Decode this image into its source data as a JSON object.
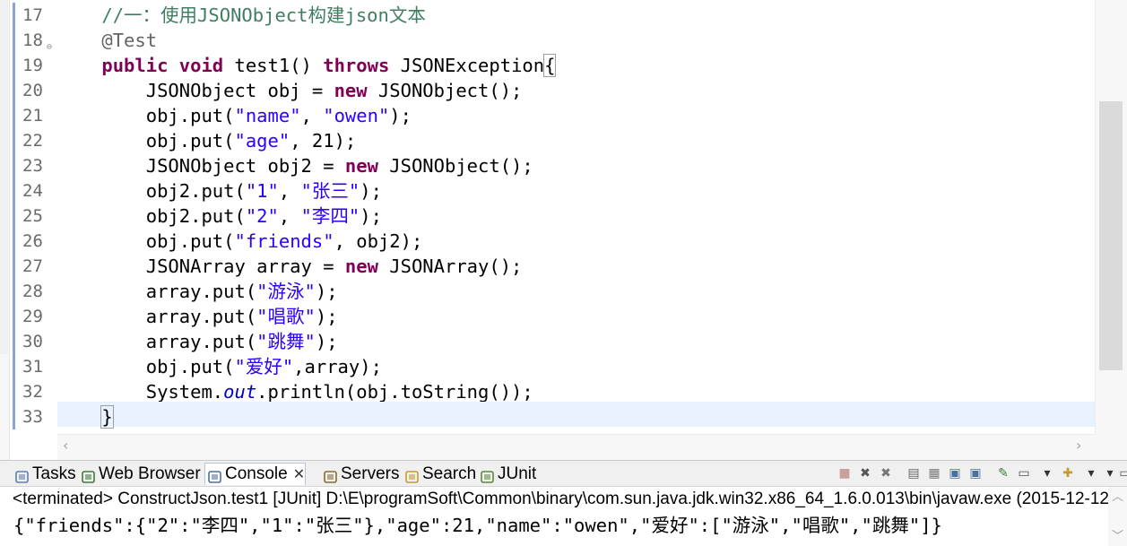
{
  "editor": {
    "first_line_number": 17,
    "lines": [
      {
        "num": "17",
        "tokens": [
          {
            "t": "    "
          },
          {
            "t": "//一：使用JSONObject构建json文本",
            "c": "cmt"
          }
        ]
      },
      {
        "num": "18",
        "fold": true,
        "tokens": [
          {
            "t": "    "
          },
          {
            "t": "@Test",
            "c": "ann"
          }
        ]
      },
      {
        "num": "19",
        "tokens": [
          {
            "t": "    "
          },
          {
            "t": "public",
            "c": "kw"
          },
          {
            "t": " "
          },
          {
            "t": "void",
            "c": "kw"
          },
          {
            "t": " test1() "
          },
          {
            "t": "throws",
            "c": "kw"
          },
          {
            "t": " JSONException"
          },
          {
            "t": "{",
            "c": "bracket"
          }
        ]
      },
      {
        "num": "20",
        "tokens": [
          {
            "t": "        JSONObject obj = "
          },
          {
            "t": "new",
            "c": "kw"
          },
          {
            "t": " JSONObject();"
          }
        ]
      },
      {
        "num": "21",
        "tokens": [
          {
            "t": "        obj.put("
          },
          {
            "t": "\"name\"",
            "c": "str"
          },
          {
            "t": ", "
          },
          {
            "t": "\"owen\"",
            "c": "str"
          },
          {
            "t": ");"
          }
        ]
      },
      {
        "num": "22",
        "tokens": [
          {
            "t": "        obj.put("
          },
          {
            "t": "\"age\"",
            "c": "str"
          },
          {
            "t": ", 21);"
          }
        ]
      },
      {
        "num": "23",
        "tokens": [
          {
            "t": "        JSONObject obj2 = "
          },
          {
            "t": "new",
            "c": "kw"
          },
          {
            "t": " JSONObject();"
          }
        ]
      },
      {
        "num": "24",
        "tokens": [
          {
            "t": "        obj2.put("
          },
          {
            "t": "\"1\"",
            "c": "str"
          },
          {
            "t": ", "
          },
          {
            "t": "\"张三\"",
            "c": "str"
          },
          {
            "t": ");"
          }
        ]
      },
      {
        "num": "25",
        "tokens": [
          {
            "t": "        obj2.put("
          },
          {
            "t": "\"2\"",
            "c": "str"
          },
          {
            "t": ", "
          },
          {
            "t": "\"李四\"",
            "c": "str"
          },
          {
            "t": ");"
          }
        ]
      },
      {
        "num": "26",
        "tokens": [
          {
            "t": "        obj.put("
          },
          {
            "t": "\"friends\"",
            "c": "str"
          },
          {
            "t": ", obj2);"
          }
        ]
      },
      {
        "num": "27",
        "tokens": [
          {
            "t": "        JSONArray array = "
          },
          {
            "t": "new",
            "c": "kw"
          },
          {
            "t": " JSONArray();"
          }
        ]
      },
      {
        "num": "28",
        "tokens": [
          {
            "t": "        array.put("
          },
          {
            "t": "\"游泳\"",
            "c": "str"
          },
          {
            "t": ");"
          }
        ]
      },
      {
        "num": "29",
        "tokens": [
          {
            "t": "        array.put("
          },
          {
            "t": "\"唱歌\"",
            "c": "str"
          },
          {
            "t": ");"
          }
        ]
      },
      {
        "num": "30",
        "tokens": [
          {
            "t": "        array.put("
          },
          {
            "t": "\"跳舞\"",
            "c": "str"
          },
          {
            "t": ");"
          }
        ]
      },
      {
        "num": "31",
        "tokens": [
          {
            "t": "        obj.put("
          },
          {
            "t": "\"爱好\"",
            "c": "str"
          },
          {
            "t": ",array);"
          }
        ]
      },
      {
        "num": "32",
        "tokens": [
          {
            "t": "        System."
          },
          {
            "t": "out",
            "c": "fld"
          },
          {
            "t": ".println(obj.toString());"
          }
        ]
      },
      {
        "num": "33",
        "current": true,
        "tokens": [
          {
            "t": "    "
          },
          {
            "t": "}",
            "c": "bracket"
          }
        ]
      }
    ]
  },
  "panel": {
    "tabs": [
      {
        "label": "Tasks",
        "icon": "tasks-icon",
        "color": "#5b7fb5"
      },
      {
        "label": "Web Browser",
        "icon": "globe-icon",
        "color": "#3c7a3c"
      },
      {
        "label": "Console",
        "icon": "console-icon",
        "color": "#4a6fa5",
        "active": true,
        "close": "✕"
      },
      {
        "label": "Servers",
        "icon": "servers-icon",
        "color": "#8a6b2e"
      },
      {
        "label": "Search",
        "icon": "search-icon",
        "color": "#c59a2e"
      },
      {
        "label": "JUnit",
        "icon": "junit-icon",
        "color": "#5a8a3a"
      }
    ],
    "toolbar": [
      {
        "name": "terminate-icon",
        "glyph": "■",
        "color": "#c8a0a0"
      },
      {
        "name": "remove-launch-icon",
        "glyph": "✖",
        "color": "#555555"
      },
      {
        "name": "remove-all-icon",
        "glyph": "✖",
        "color": "#777777"
      },
      {
        "name": "clear-console-icon",
        "glyph": "▤",
        "color": "#666666"
      },
      {
        "name": "scroll-lock-icon",
        "glyph": "▦",
        "color": "#7a7a7a"
      },
      {
        "name": "word-wrap-icon",
        "glyph": "▣",
        "color": "#4a6fa5"
      },
      {
        "name": "show-on-output-icon",
        "glyph": "▣",
        "color": "#4a6fa5"
      },
      {
        "name": "pin-console-icon",
        "glyph": "✎",
        "color": "#3c7a3c"
      },
      {
        "name": "display-console-icon",
        "glyph": "▭",
        "color": "#555555"
      },
      {
        "name": "display-console-dropdown-icon",
        "glyph": "▾",
        "color": "#333333"
      },
      {
        "name": "open-console-icon",
        "glyph": "✚",
        "color": "#c59a2e"
      },
      {
        "name": "open-console-dropdown-icon",
        "glyph": "▾",
        "color": "#333333"
      },
      {
        "name": "view-menu-icon",
        "glyph": "▾",
        "color": "#333333"
      },
      {
        "name": "minimize-icon",
        "glyph": "▭",
        "color": "#555555"
      }
    ],
    "status": "<terminated> ConstructJson.test1 [JUnit] D:\\E\\programSoft\\Common\\binary\\com.sun.java.jdk.win32.x86_64_1.6.0.013\\bin\\javaw.exe (2015-12-12",
    "output": "{\"friends\":{\"2\":\"李四\",\"1\":\"张三\"},\"age\":21,\"name\":\"owen\",\"爱好\":[\"游泳\",\"唱歌\",\"跳舞\"]}"
  }
}
